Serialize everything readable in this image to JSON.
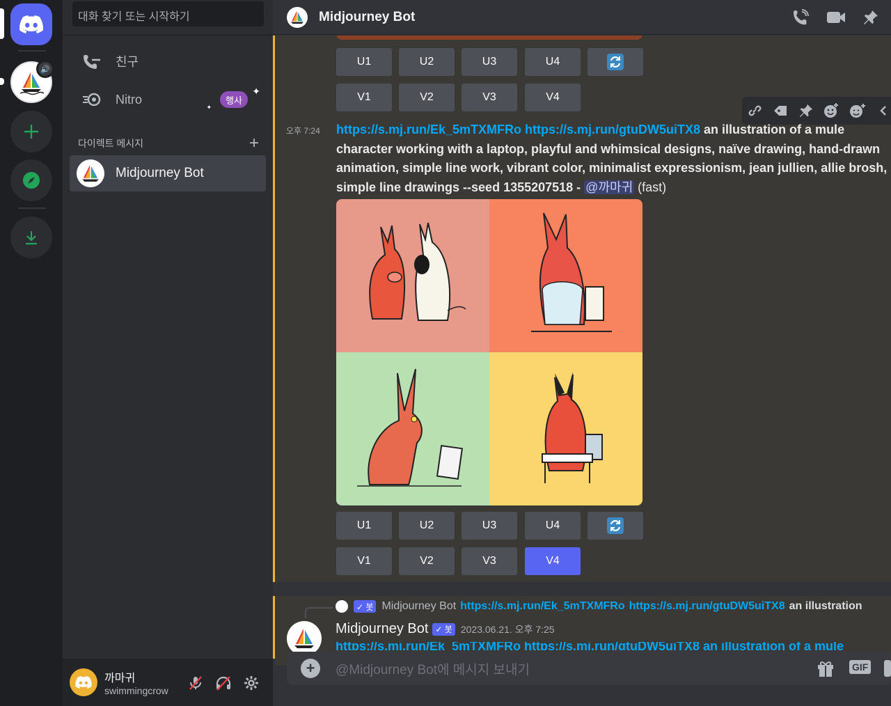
{
  "search": {
    "placeholder": "대화 찾기 또는 시작하기"
  },
  "sidebar": {
    "friends_label": "친구",
    "nitro_label": "Nitro",
    "nitro_badge": "행사",
    "dm_header": "다이렉트 메시지",
    "dm_add": "+",
    "dms": [
      {
        "name": "Midjourney Bot"
      }
    ]
  },
  "user": {
    "display_name": "까마귀",
    "username": "swimmingcrow"
  },
  "channel": {
    "title": "Midjourney Bot"
  },
  "buttons": {
    "u": [
      "U1",
      "U2",
      "U3",
      "U4"
    ],
    "v": [
      "V1",
      "V2",
      "V3",
      "V4"
    ]
  },
  "message": {
    "time": "오후 7:24",
    "link1": "https://s.mj.run/Ek_5mTXMFRo",
    "link2": "https://s.mj.run/gtuDW5uiTX8",
    "prompt": " an illustration of a mule character working with a laptop, playful and whimsical designs, naïve drawing, hand-drawn animation, simple line work, vibrant color, minimalist expressionism, jean jullien, allie brosh, simple line drawings --seed 1355207518",
    "dash": " - ",
    "mention": "@까마귀",
    "speed": " (fast)"
  },
  "reply": {
    "bot_tag": "✓ 봇",
    "name": "Midjourney Bot",
    "link1": "https://s.mj.run/Ek_5mTXMFRo",
    "link2": "https://s.mj.run/gtuDW5uiTX8",
    "text": "an illustration"
  },
  "next_message": {
    "author": "Midjourney Bot",
    "bot_tag": "✓ 봇",
    "timestamp": "2023.06.21. 오후 7:25",
    "partial_link": "https://s.mj.run/Ek_5mTXMFRo https://s.mj.run/gtuDW5uiTX8 an illustration of a mule"
  },
  "composer": {
    "placeholder": "@Midjourney Bot에 메시지 보내기",
    "gif_label": "GIF"
  },
  "colors": {
    "accent": "#5865f2",
    "link": "#00a8fc",
    "highlight_bar": "#f0b232",
    "quad1": "#e7998a",
    "quad2": "#f7845f",
    "quad3": "#b8e0b1",
    "quad4": "#fbd56d"
  }
}
